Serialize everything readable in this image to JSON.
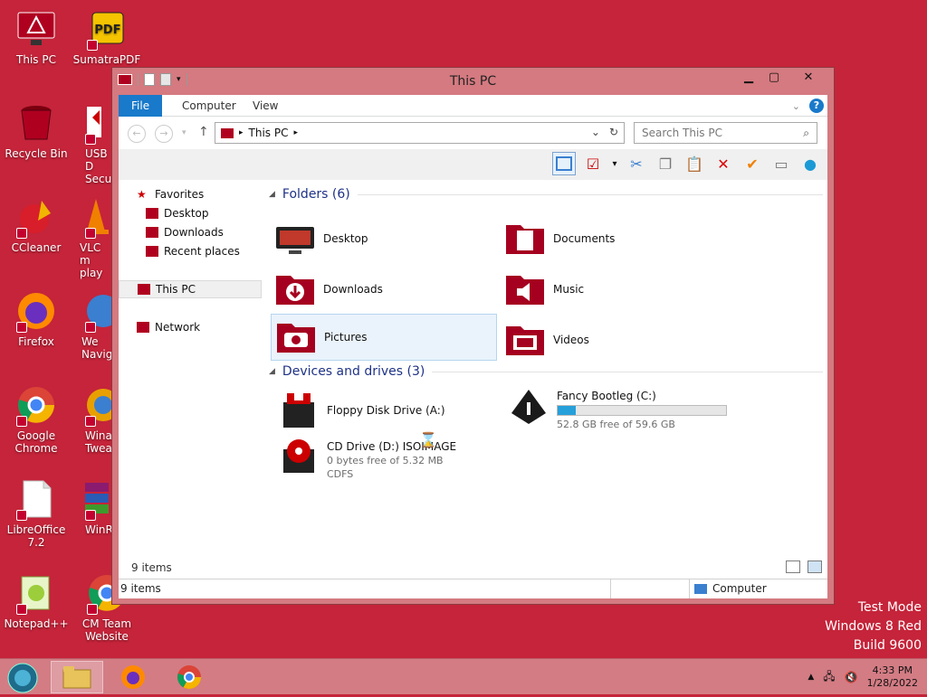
{
  "desktop": {
    "icons": [
      {
        "label": "This PC"
      },
      {
        "label": "SumatraPDF"
      },
      {
        "label": "Recycle Bin"
      },
      {
        "label": "USB D\nSecu"
      },
      {
        "label": "CCleaner"
      },
      {
        "label": "VLC m\nplay"
      },
      {
        "label": "Firefox"
      },
      {
        "label": "We\nNaviga"
      },
      {
        "label": "Google\nChrome"
      },
      {
        "label": "Wina\nTwea"
      },
      {
        "label": "LibreOffice\n7.2"
      },
      {
        "label": "WinR"
      },
      {
        "label": "Notepad++"
      },
      {
        "label": "CM Team\nWebsite"
      }
    ],
    "watermark": [
      "Test Mode",
      "Windows 8 Red",
      "Build 9600"
    ]
  },
  "window": {
    "title": "This PC",
    "ribbon_tabs": [
      "File",
      "Computer",
      "View"
    ],
    "address": "This PC",
    "search_placeholder": "Search This PC",
    "nav": {
      "favorites": "Favorites",
      "desktop": "Desktop",
      "downloads": "Downloads",
      "recent": "Recent places",
      "this_pc": "This PC",
      "network": "Network"
    },
    "folders_header": "Folders (6)",
    "folders": [
      "Desktop",
      "Documents",
      "Downloads",
      "Music",
      "Pictures",
      "Videos"
    ],
    "devices_header": "Devices and drives (3)",
    "drives": [
      {
        "name": "Floppy Disk Drive (A:)"
      },
      {
        "name": "Fancy Bootleg (C:)",
        "free": "52.8 GB free of 59.6 GB",
        "used_fraction": 0.11
      },
      {
        "name": "CD Drive (D:) ISOIMAGE",
        "free": "0 bytes free of 5.32 MB",
        "fs": "CDFS"
      }
    ],
    "item_count": "9 items",
    "status_left": "9 items",
    "status_right": "Computer"
  },
  "taskbar": {
    "time": "4:33 PM",
    "date": "1/28/2022"
  },
  "colors": {
    "desktop": "#c5243a",
    "accent": "#1979ca"
  }
}
